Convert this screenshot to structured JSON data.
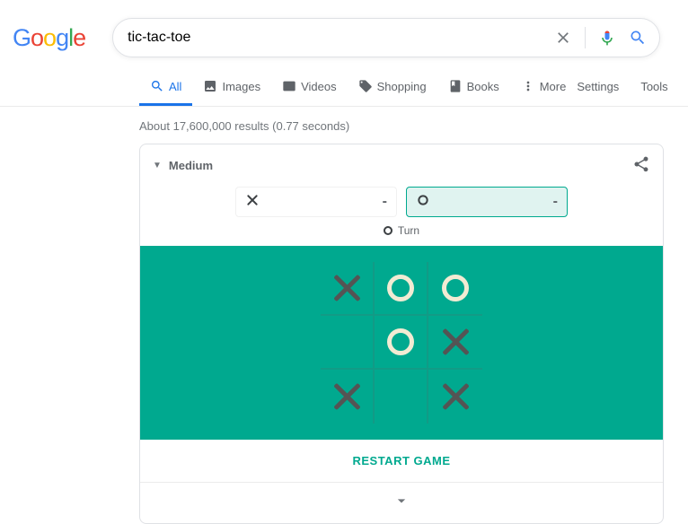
{
  "logo": {
    "g1": "G",
    "o1": "o",
    "o2": "o",
    "g2": "g",
    "l": "l",
    "e": "e"
  },
  "search": {
    "query": "tic-tac-toe"
  },
  "tabs": {
    "all": "All",
    "images": "Images",
    "videos": "Videos",
    "shopping": "Shopping",
    "books": "Books",
    "more": "More",
    "settings": "Settings",
    "tools": "Tools"
  },
  "stats": "About 17,600,000 results (0.77 seconds)",
  "ttt": {
    "difficulty": "Medium",
    "x_score": "-",
    "o_score": "-",
    "turn_label": "Turn",
    "turn_player": "O",
    "board": [
      [
        "X",
        "O",
        "O"
      ],
      [
        "",
        "O",
        "X"
      ],
      [
        "X",
        "",
        "X"
      ]
    ],
    "restart": "RESTART GAME"
  }
}
